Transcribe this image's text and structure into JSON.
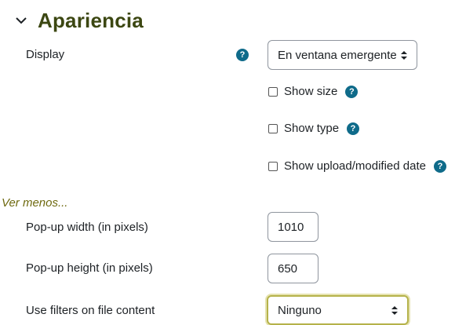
{
  "section": {
    "title": "Apariencia",
    "toggle_icon": "chevron-down-icon"
  },
  "display": {
    "label": "Display",
    "help_glyph": "?",
    "selected": "En ventana emergente"
  },
  "checkboxes": [
    {
      "label": "Show size",
      "checked": false
    },
    {
      "label": "Show type",
      "checked": false
    },
    {
      "label": "Show upload/modified date",
      "checked": false
    }
  ],
  "show_less_link": "Ver menos...",
  "popup_width": {
    "label": "Pop-up width (in pixels)",
    "value": "1010"
  },
  "popup_height": {
    "label": "Pop-up height (in pixels)",
    "value": "650"
  },
  "filters": {
    "label": "Use filters on file content",
    "selected": "Ninguno"
  },
  "colors": {
    "title": "#3c4712",
    "help": "#0f6b8a",
    "link": "#6f6a10",
    "focus": "#b5b24a"
  }
}
